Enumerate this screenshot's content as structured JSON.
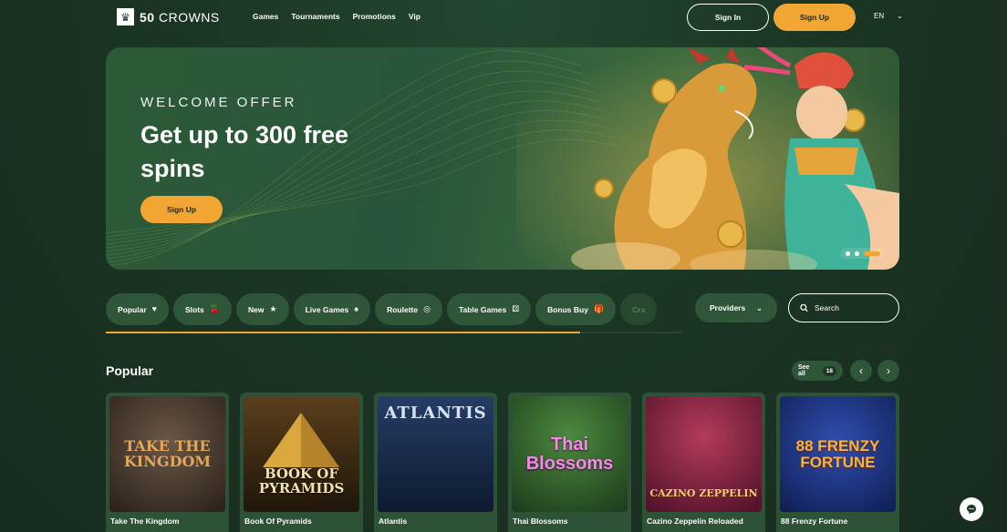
{
  "header": {
    "logo_badge_icon": "crown-icon",
    "logo_text_bold": "50",
    "logo_text": "CROWNS",
    "nav": [
      "Games",
      "Tournaments",
      "Promotions",
      "Vip"
    ],
    "signin_label": "Sign In",
    "signup_label": "Sign Up",
    "language": "EN"
  },
  "hero": {
    "eyebrow": "WELCOME OFFER",
    "title": "Get up to 300 free spins",
    "cta_label": "Sign Up"
  },
  "categories": {
    "items": [
      {
        "label": "Popular",
        "icon": "heart-icon"
      },
      {
        "label": "Slots",
        "icon": "cherries-icon"
      },
      {
        "label": "New",
        "icon": "star-icon"
      },
      {
        "label": "Live Games",
        "icon": "spade-icon"
      },
      {
        "label": "Roulette",
        "icon": "roulette-icon"
      },
      {
        "label": "Table Games",
        "icon": "dice-icon"
      },
      {
        "label": "Bonus Buy",
        "icon": "gift-icon"
      },
      {
        "label": "Cra",
        "icon": ""
      }
    ],
    "providers_label": "Providers",
    "search_placeholder": "Search"
  },
  "popular": {
    "title": "Popular",
    "see_all_label": "See all",
    "count": "18",
    "games": [
      {
        "name": "Take The Kingdom",
        "thumb_title": "TAKE THE KINGDOM",
        "bg": "#4a3a2f",
        "accent": "#d49b4a"
      },
      {
        "name": "Book Of Pyramids",
        "thumb_title": "BOOK OF PYRAMIDS",
        "bg": "#3a2b17",
        "accent": "#f0c75a"
      },
      {
        "name": "Atlantis",
        "thumb_title": "ATLANTIS",
        "bg": "#1b2e4f",
        "accent": "#cfd9ee"
      },
      {
        "name": "Thai Blossoms",
        "thumb_title": "Thai Blossoms",
        "bg": "#2b4a2a",
        "accent": "#e06ad6"
      },
      {
        "name": "Cazino Zeppelin Reloaded",
        "thumb_title": "CAZINO ZEPPELIN",
        "bg": "#6a1e36",
        "accent": "#f0c060"
      },
      {
        "name": "88 Frenzy Fortune",
        "thumb_title": "88 FRENZY FORTUNE",
        "bg": "#18307a",
        "accent": "#f3b43a"
      }
    ]
  },
  "colors": {
    "accent": "#f1a533",
    "chip_bg": "#2f5638",
    "page_bg": "#1b3524"
  }
}
